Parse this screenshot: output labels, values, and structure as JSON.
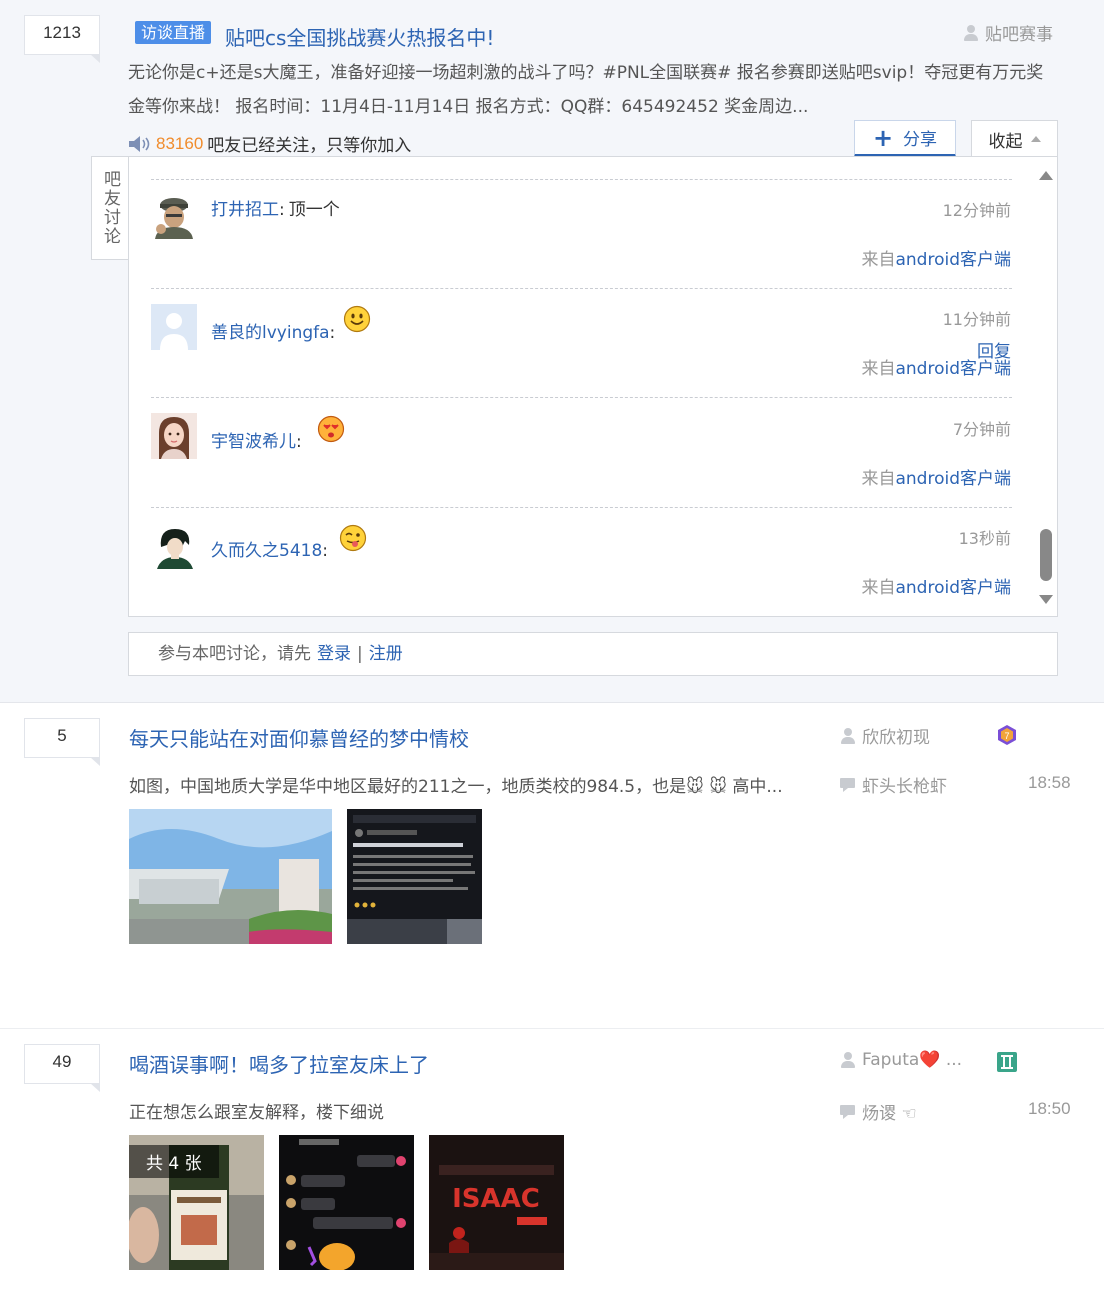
{
  "thread1": {
    "reply_count": "1213",
    "badge": "访谈直播",
    "title": "贴吧cs全国挑战赛火热报名中!",
    "author": "贴吧赛事",
    "desc": "无论你是c+还是s大魔王，准备好迎接一场超刺激的战斗了吗？#PNL全国联赛# 报名参赛即送贴吧svip！夺冠更有万元奖金等你来战！ 报名时间：11月4日-11月14日 报名方式：QQ群：645492452 奖金周边...",
    "fans_count": "83160",
    "fans_text": "吧友已经关注，只等你加入",
    "share_label": "分享",
    "collapse_label": "收起",
    "side_tab": "吧友讨论",
    "comments": [
      {
        "name": "打井招工",
        "text": "顶一个",
        "time": "12分钟前",
        "source_prefix": "来自",
        "source_link": "android客户端"
      },
      {
        "name": "善良的lvyingfa",
        "text": "",
        "time": "11分钟前",
        "reply": "回复",
        "source_prefix": "来自",
        "source_link": "android客户端"
      },
      {
        "name": "宇智波希儿",
        "text": "",
        "time": "7分钟前",
        "source_prefix": "来自",
        "source_link": "android客户端"
      },
      {
        "name": "久而久之5418",
        "text": "",
        "time": "13秒前",
        "source_prefix": "来自",
        "source_link": "android客户端"
      }
    ],
    "login_prompt": "参与本吧讨论，请先",
    "login_link": "登录",
    "sep": "|",
    "register_link": "注册"
  },
  "thread2": {
    "reply_count": "5",
    "title": "每天只能站在对面仰慕曾经的梦中情校",
    "author": "欣欣初现",
    "desc": "如图，中国地质大学是华中地区最好的211之一，地质类校的984.5，也是🐭 🐭 高中...",
    "last_replier": "虾头长枪虾",
    "time": "18:58"
  },
  "thread3": {
    "reply_count": "49",
    "title": "喝酒误事啊！喝多了拉室友床上了",
    "author": "Faputa❤️ ...",
    "desc": "正在想怎么跟室友解释，楼下细说",
    "last_replier": "炀谡 ☜",
    "time": "18:50",
    "image_count": "共 4 张"
  }
}
